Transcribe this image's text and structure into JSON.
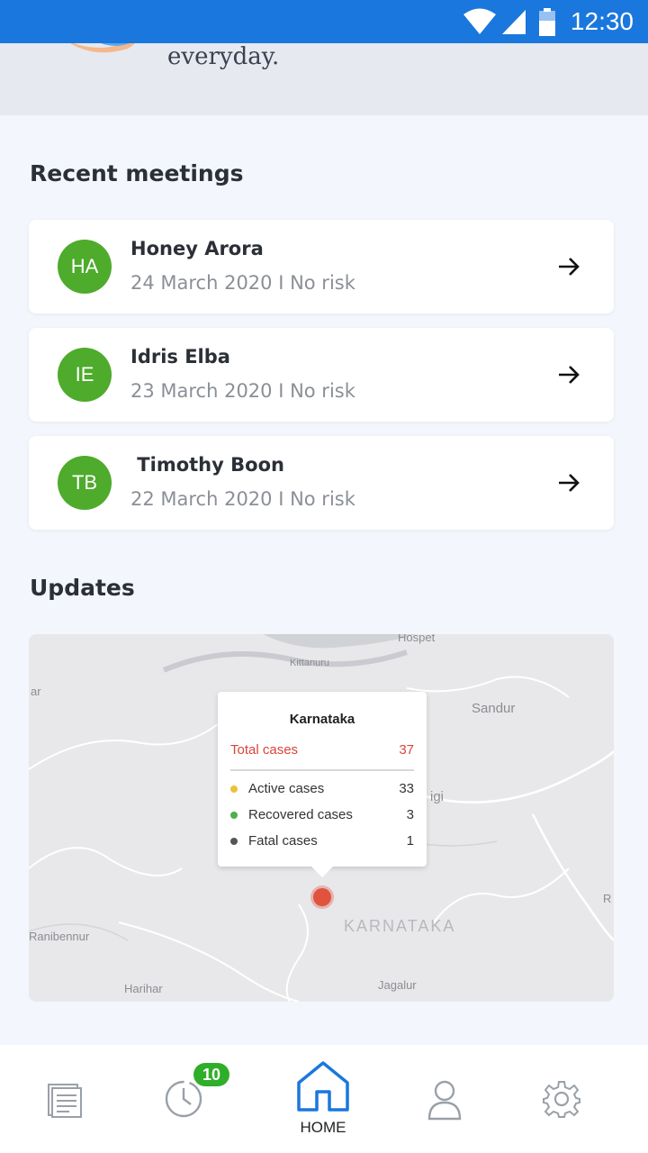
{
  "status_bar": {
    "time": "12:30",
    "wifi_icon": "wifi-icon",
    "signal_icon": "signal-icon",
    "battery_icon": "battery-icon"
  },
  "banner": {
    "text": "everyday.",
    "illustration_icon": "hand-illustration"
  },
  "recent_meetings": {
    "title": "Recent meetings",
    "items": [
      {
        "initials": "HA",
        "name": "Honey Arora",
        "meta": "24 March 2020 I No risk"
      },
      {
        "initials": "IE",
        "name": "Idris Elba",
        "meta": "23 March 2020 I No risk"
      },
      {
        "initials": "TB",
        "name": " Timothy Boon",
        "meta": "22 March 2020 I No risk"
      }
    ]
  },
  "updates": {
    "title": "Updates",
    "map": {
      "place_labels": [
        "Hospet",
        "Kittanuru",
        "ar",
        "Sandur",
        "igi",
        "R",
        "KARNATAKA",
        "Ranibennur",
        "Harihar",
        "Jagalur"
      ],
      "popup": {
        "title": "Karnataka",
        "total_label": "Total cases",
        "total_value": "37",
        "rows": [
          {
            "label": "Active cases",
            "value": "33",
            "color": "#e8c23a"
          },
          {
            "label": "Recovered cases",
            "value": "3",
            "color": "#4caf50"
          },
          {
            "label": "Fatal cases",
            "value": "1",
            "color": "#555555"
          }
        ],
        "total_color": "#d9453b"
      }
    }
  },
  "bottom_nav": {
    "items": [
      {
        "name": "reports",
        "icon": "document-icon"
      },
      {
        "name": "history",
        "icon": "clock-icon",
        "badge": "10"
      },
      {
        "name": "home",
        "icon": "home-icon",
        "label": "HOME",
        "active": true
      },
      {
        "name": "profile",
        "icon": "person-icon"
      },
      {
        "name": "settings",
        "icon": "gear-icon"
      }
    ]
  },
  "colors": {
    "status_bar": "#1a77dd",
    "accent": "#1a77dd",
    "avatar": "#4eab2c",
    "badge": "#2fae2a"
  }
}
